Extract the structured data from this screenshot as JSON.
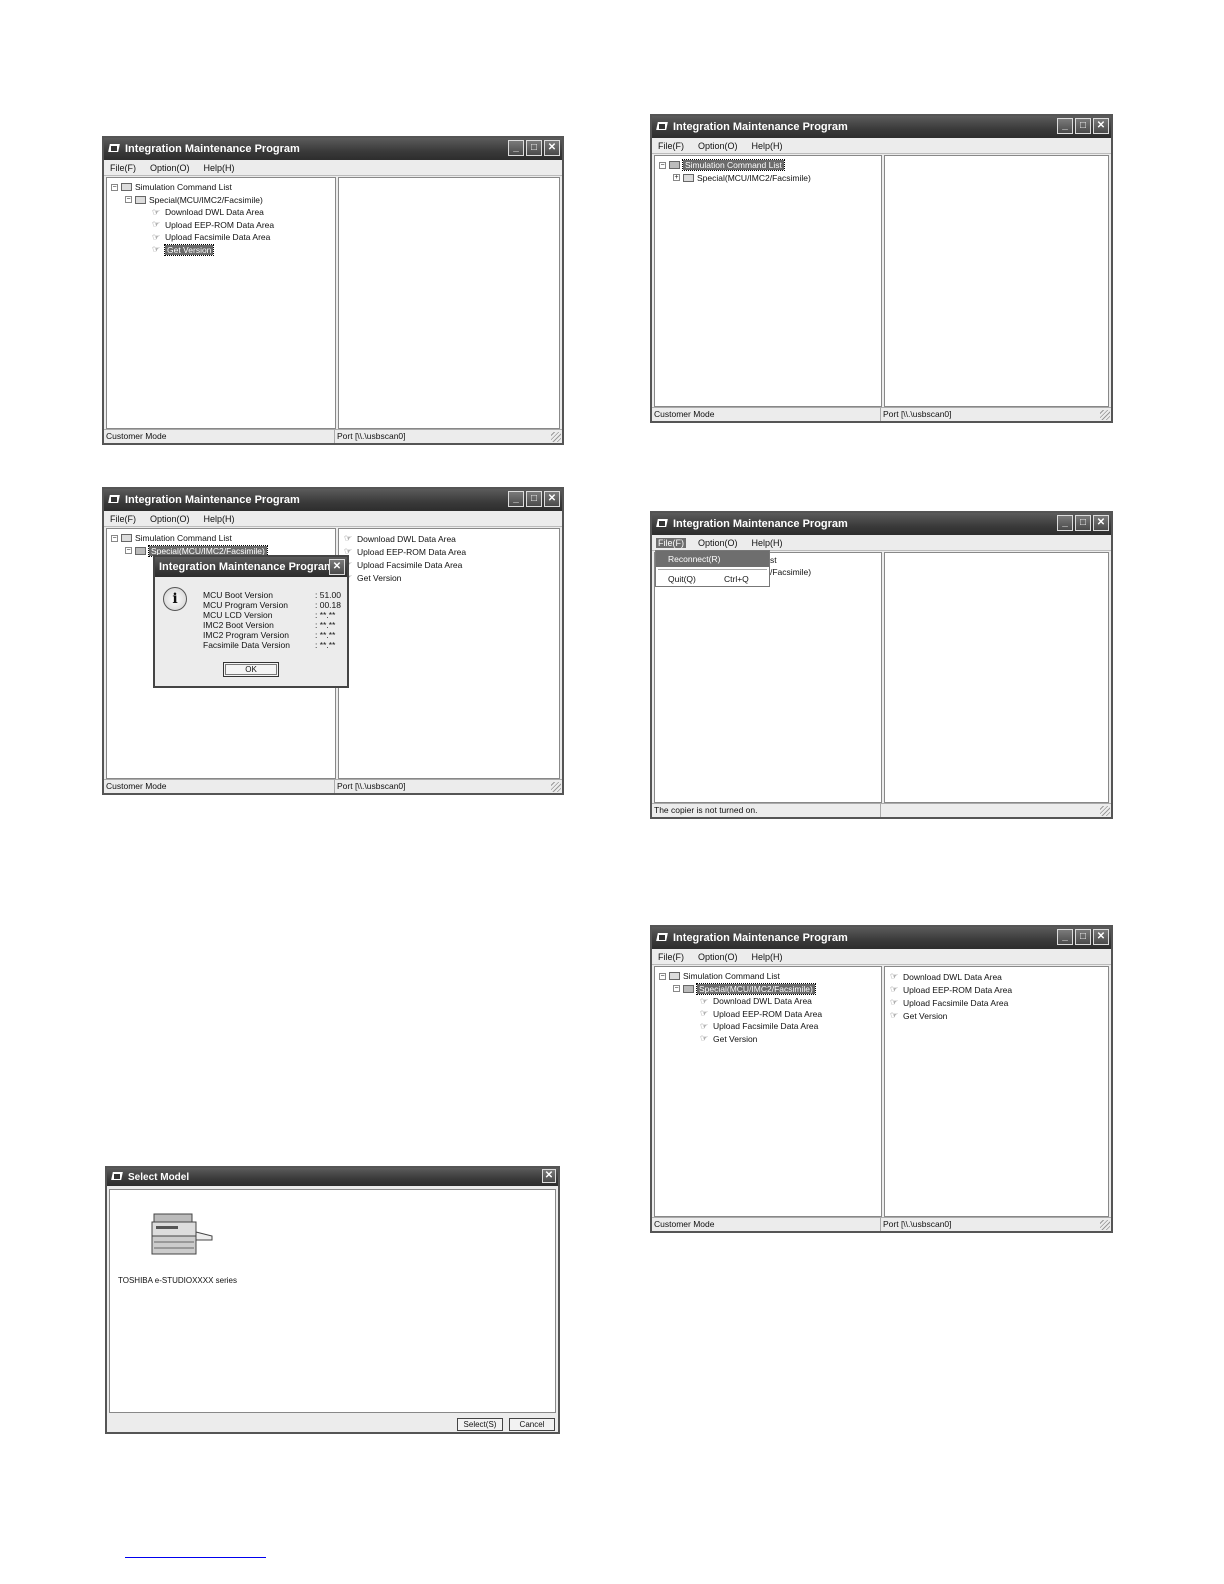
{
  "app_title": "Integration Maintenance Program",
  "menu": {
    "file": "File(F)",
    "option": "Option(O)",
    "help": "Help(H)"
  },
  "window_buttons": {
    "minimize": "_",
    "maximize": "□",
    "close": "✕"
  },
  "tree": {
    "root": "Simulation Command List",
    "special": "Special(MCU/IMC2/Facsimile)",
    "items": [
      "Download DWL Data Area",
      "Upload EEP-ROM Data Area",
      "Upload Facsimile Data Area",
      "Get Version"
    ]
  },
  "status": {
    "mode": "Customer Mode",
    "port": "Port [\\\\.\\usbscan0]",
    "copier_off": "The copier is not turned on."
  },
  "version_dialog": {
    "title": "Integration Maintenance Program",
    "rows": [
      {
        "label": "MCU Boot Version",
        "value": ": 51.00"
      },
      {
        "label": "MCU Program Version",
        "value": ": 00.18"
      },
      {
        "label": "MCU LCD Version",
        "value": ": **.**"
      },
      {
        "label": "IMC2 Boot Version",
        "value": ": **.**"
      },
      {
        "label": "IMC2 Program Version",
        "value": ": **.**"
      },
      {
        "label": "Facsimile Data Version",
        "value": ": **.**"
      }
    ],
    "ok": "OK"
  },
  "file_menu": {
    "reconnect": "Reconnect(R)",
    "quit": "Quit(Q)",
    "quit_shortcut": "Ctrl+Q",
    "partial_root": "st",
    "partial_special": "/Facsimile)"
  },
  "select_model": {
    "title": "Select Model",
    "model": "TOSHIBA e-STUDIOXXXX series",
    "select": "Select(S)",
    "cancel": "Cancel"
  },
  "icons": {
    "plus": "+",
    "minus": "−",
    "hand": "☞",
    "info": "i"
  }
}
